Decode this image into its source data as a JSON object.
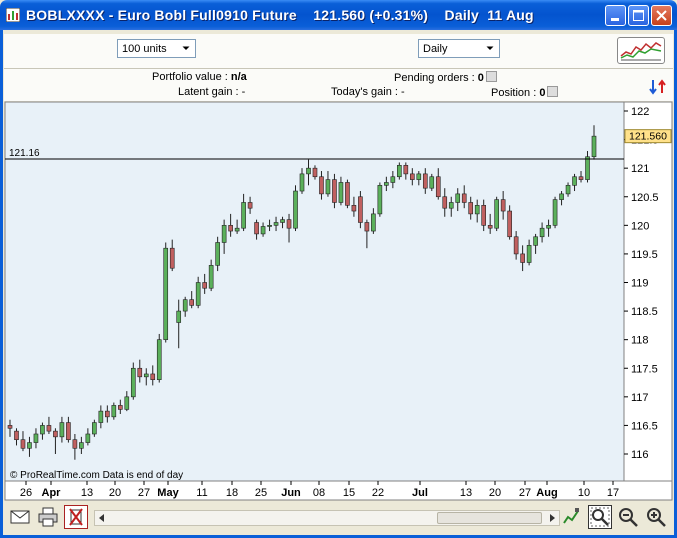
{
  "window": {
    "title": "BOBLXXXX - Euro Bobl Full0910 Future",
    "price_text": "121.560 (+0.31%)",
    "period": "Daily",
    "date": "11 Aug"
  },
  "toolbar": {
    "units_value": "100 units",
    "period_value": "Daily"
  },
  "info": {
    "portfolio_label": "Portfolio value :",
    "portfolio_value": "n/a",
    "pending_label": "Pending orders :",
    "pending_value": "0",
    "latent_label": "Latent gain :",
    "latent_value": "-",
    "today_label": "Today's gain :",
    "today_value": "-",
    "position_label": "Position :",
    "position_value": "0"
  },
  "chart": {
    "level_line_label": "121.16",
    "last_price_label": "121.560",
    "copyright": "© ProRealTime.com  Data is end of day",
    "y_ticks": [
      "122",
      "121.5",
      "121",
      "120.5",
      "120",
      "119.5",
      "119",
      "118.5",
      "118",
      "117.5",
      "117",
      "116.5",
      "116"
    ],
    "x_ticks": [
      {
        "label": "26",
        "bold": false
      },
      {
        "label": "Apr",
        "bold": true
      },
      {
        "label": "13",
        "bold": false
      },
      {
        "label": "20",
        "bold": false
      },
      {
        "label": "27",
        "bold": false
      },
      {
        "label": "May",
        "bold": true
      },
      {
        "label": "11",
        "bold": false
      },
      {
        "label": "18",
        "bold": false
      },
      {
        "label": "25",
        "bold": false
      },
      {
        "label": "Jun",
        "bold": true
      },
      {
        "label": "08",
        "bold": false
      },
      {
        "label": "15",
        "bold": false
      },
      {
        "label": "22",
        "bold": false
      },
      {
        "label": "Jul",
        "bold": true
      },
      {
        "label": "13",
        "bold": false
      },
      {
        "label": "20",
        "bold": false
      },
      {
        "label": "27",
        "bold": false
      },
      {
        "label": "Aug",
        "bold": true
      },
      {
        "label": "10",
        "bold": false
      },
      {
        "label": "17",
        "bold": false
      }
    ]
  },
  "chart_data": {
    "type": "candlestick",
    "level_line": 121.16,
    "last_price": 121.56,
    "ylim": [
      115.6,
      122.2
    ],
    "candles": [
      {
        "o": 116.5,
        "h": 116.6,
        "l": 116.3,
        "c": 116.45
      },
      {
        "o": 116.4,
        "h": 116.45,
        "l": 116.15,
        "c": 116.25
      },
      {
        "o": 116.25,
        "h": 116.4,
        "l": 116.05,
        "c": 116.1
      },
      {
        "o": 116.1,
        "h": 116.3,
        "l": 115.95,
        "c": 116.2
      },
      {
        "o": 116.2,
        "h": 116.45,
        "l": 116.1,
        "c": 116.35
      },
      {
        "o": 116.35,
        "h": 116.55,
        "l": 116.25,
        "c": 116.5
      },
      {
        "o": 116.5,
        "h": 116.65,
        "l": 116.35,
        "c": 116.4
      },
      {
        "o": 116.4,
        "h": 116.45,
        "l": 116.0,
        "c": 116.3
      },
      {
        "o": 116.3,
        "h": 116.65,
        "l": 116.2,
        "c": 116.55
      },
      {
        "o": 116.55,
        "h": 116.65,
        "l": 116.2,
        "c": 116.25
      },
      {
        "o": 116.25,
        "h": 116.35,
        "l": 115.9,
        "c": 116.1
      },
      {
        "o": 116.1,
        "h": 116.3,
        "l": 116.0,
        "c": 116.2
      },
      {
        "o": 116.2,
        "h": 116.45,
        "l": 116.15,
        "c": 116.35
      },
      {
        "o": 116.35,
        "h": 116.6,
        "l": 116.3,
        "c": 116.55
      },
      {
        "o": 116.55,
        "h": 116.85,
        "l": 116.45,
        "c": 116.75
      },
      {
        "o": 116.75,
        "h": 116.85,
        "l": 116.55,
        "c": 116.65
      },
      {
        "o": 116.65,
        "h": 116.9,
        "l": 116.6,
        "c": 116.85
      },
      {
        "o": 116.85,
        "h": 116.95,
        "l": 116.7,
        "c": 116.78
      },
      {
        "o": 116.78,
        "h": 117.1,
        "l": 116.75,
        "c": 117.0
      },
      {
        "o": 117.0,
        "h": 117.6,
        "l": 116.95,
        "c": 117.5
      },
      {
        "o": 117.5,
        "h": 117.65,
        "l": 117.25,
        "c": 117.35
      },
      {
        "o": 117.35,
        "h": 117.5,
        "l": 117.2,
        "c": 117.4
      },
      {
        "o": 117.4,
        "h": 117.55,
        "l": 117.2,
        "c": 117.3
      },
      {
        "o": 117.3,
        "h": 118.1,
        "l": 117.25,
        "c": 118.0
      },
      {
        "o": 118.0,
        "h": 119.7,
        "l": 117.95,
        "c": 119.6
      },
      {
        "o": 119.6,
        "h": 119.75,
        "l": 119.2,
        "c": 119.25
      },
      {
        "o": 118.3,
        "h": 118.7,
        "l": 117.85,
        "c": 118.5
      },
      {
        "o": 118.5,
        "h": 118.75,
        "l": 118.4,
        "c": 118.7
      },
      {
        "o": 118.7,
        "h": 118.85,
        "l": 118.55,
        "c": 118.6
      },
      {
        "o": 118.6,
        "h": 119.1,
        "l": 118.55,
        "c": 119.0
      },
      {
        "o": 119.0,
        "h": 119.15,
        "l": 118.8,
        "c": 118.9
      },
      {
        "o": 118.9,
        "h": 119.4,
        "l": 118.85,
        "c": 119.3
      },
      {
        "o": 119.3,
        "h": 119.8,
        "l": 119.2,
        "c": 119.7
      },
      {
        "o": 119.7,
        "h": 120.1,
        "l": 119.5,
        "c": 120.0
      },
      {
        "o": 120.0,
        "h": 120.2,
        "l": 119.8,
        "c": 119.9
      },
      {
        "o": 119.9,
        "h": 120.1,
        "l": 119.85,
        "c": 119.95
      },
      {
        "o": 119.95,
        "h": 120.55,
        "l": 119.9,
        "c": 120.4
      },
      {
        "o": 120.4,
        "h": 120.5,
        "l": 120.2,
        "c": 120.3
      },
      {
        "o": 120.05,
        "h": 120.1,
        "l": 119.75,
        "c": 119.85
      },
      {
        "o": 119.85,
        "h": 120.05,
        "l": 119.8,
        "c": 119.98
      },
      {
        "o": 119.98,
        "h": 120.1,
        "l": 119.9,
        "c": 120.0
      },
      {
        "o": 120.0,
        "h": 120.15,
        "l": 119.9,
        "c": 120.05
      },
      {
        "o": 120.05,
        "h": 120.15,
        "l": 119.95,
        "c": 120.1
      },
      {
        "o": 120.1,
        "h": 120.2,
        "l": 119.7,
        "c": 119.95
      },
      {
        "o": 119.95,
        "h": 120.7,
        "l": 119.9,
        "c": 120.6
      },
      {
        "o": 120.6,
        "h": 121.0,
        "l": 120.55,
        "c": 120.9
      },
      {
        "o": 120.9,
        "h": 121.15,
        "l": 120.7,
        "c": 121.0
      },
      {
        "o": 121.0,
        "h": 121.05,
        "l": 120.8,
        "c": 120.85
      },
      {
        "o": 120.85,
        "h": 120.95,
        "l": 120.45,
        "c": 120.55
      },
      {
        "o": 120.55,
        "h": 120.95,
        "l": 120.5,
        "c": 120.8
      },
      {
        "o": 120.8,
        "h": 120.9,
        "l": 120.3,
        "c": 120.4
      },
      {
        "o": 120.4,
        "h": 120.85,
        "l": 120.35,
        "c": 120.75
      },
      {
        "o": 120.75,
        "h": 120.8,
        "l": 120.3,
        "c": 120.35
      },
      {
        "o": 120.35,
        "h": 120.5,
        "l": 120.15,
        "c": 120.25
      },
      {
        "o": 120.5,
        "h": 120.6,
        "l": 119.95,
        "c": 120.05
      },
      {
        "o": 120.05,
        "h": 120.1,
        "l": 119.6,
        "c": 119.9
      },
      {
        "o": 119.9,
        "h": 120.3,
        "l": 119.85,
        "c": 120.2
      },
      {
        "o": 120.2,
        "h": 120.75,
        "l": 120.15,
        "c": 120.7
      },
      {
        "o": 120.7,
        "h": 120.85,
        "l": 120.6,
        "c": 120.75
      },
      {
        "o": 120.75,
        "h": 120.95,
        "l": 120.65,
        "c": 120.85
      },
      {
        "o": 120.85,
        "h": 121.1,
        "l": 120.8,
        "c": 121.05
      },
      {
        "o": 121.05,
        "h": 121.1,
        "l": 120.8,
        "c": 120.9
      },
      {
        "o": 120.9,
        "h": 121.0,
        "l": 120.7,
        "c": 120.8
      },
      {
        "o": 120.8,
        "h": 120.95,
        "l": 120.7,
        "c": 120.9
      },
      {
        "o": 120.9,
        "h": 121.0,
        "l": 120.55,
        "c": 120.65
      },
      {
        "o": 120.65,
        "h": 120.9,
        "l": 120.6,
        "c": 120.85
      },
      {
        "o": 120.85,
        "h": 121.0,
        "l": 120.45,
        "c": 120.5
      },
      {
        "o": 120.5,
        "h": 120.65,
        "l": 120.15,
        "c": 120.3
      },
      {
        "o": 120.3,
        "h": 120.5,
        "l": 120.15,
        "c": 120.4
      },
      {
        "o": 120.4,
        "h": 120.65,
        "l": 120.25,
        "c": 120.55
      },
      {
        "o": 120.55,
        "h": 120.7,
        "l": 120.3,
        "c": 120.4
      },
      {
        "o": 120.4,
        "h": 120.5,
        "l": 120.1,
        "c": 120.2
      },
      {
        "o": 120.2,
        "h": 120.45,
        "l": 120.05,
        "c": 120.35
      },
      {
        "o": 120.35,
        "h": 120.45,
        "l": 119.9,
        "c": 120.0
      },
      {
        "o": 120.0,
        "h": 120.2,
        "l": 119.85,
        "c": 119.95
      },
      {
        "o": 119.95,
        "h": 120.5,
        "l": 119.9,
        "c": 120.45
      },
      {
        "o": 120.45,
        "h": 120.6,
        "l": 120.1,
        "c": 120.25
      },
      {
        "o": 120.25,
        "h": 120.35,
        "l": 119.75,
        "c": 119.8
      },
      {
        "o": 119.8,
        "h": 119.9,
        "l": 119.4,
        "c": 119.5
      },
      {
        "o": 119.5,
        "h": 119.65,
        "l": 119.2,
        "c": 119.35
      },
      {
        "o": 119.35,
        "h": 119.75,
        "l": 119.3,
        "c": 119.65
      },
      {
        "o": 119.65,
        "h": 119.85,
        "l": 119.5,
        "c": 119.8
      },
      {
        "o": 119.8,
        "h": 120.05,
        "l": 119.7,
        "c": 119.95
      },
      {
        "o": 119.95,
        "h": 120.1,
        "l": 119.8,
        "c": 120.0
      },
      {
        "o": 120.0,
        "h": 120.5,
        "l": 119.95,
        "c": 120.45
      },
      {
        "o": 120.45,
        "h": 120.6,
        "l": 120.35,
        "c": 120.55
      },
      {
        "o": 120.55,
        "h": 120.75,
        "l": 120.5,
        "c": 120.7
      },
      {
        "o": 120.7,
        "h": 120.9,
        "l": 120.6,
        "c": 120.85
      },
      {
        "o": 120.85,
        "h": 120.95,
        "l": 120.75,
        "c": 120.8
      },
      {
        "o": 120.8,
        "h": 121.3,
        "l": 120.75,
        "c": 121.2
      },
      {
        "o": 121.2,
        "h": 121.75,
        "l": 121.15,
        "c": 121.56
      }
    ]
  },
  "colors": {
    "up": "#5bb05b",
    "down": "#c06060",
    "chart_bg": "#e8f1f8",
    "last_price_bg": "#ffe18a"
  }
}
